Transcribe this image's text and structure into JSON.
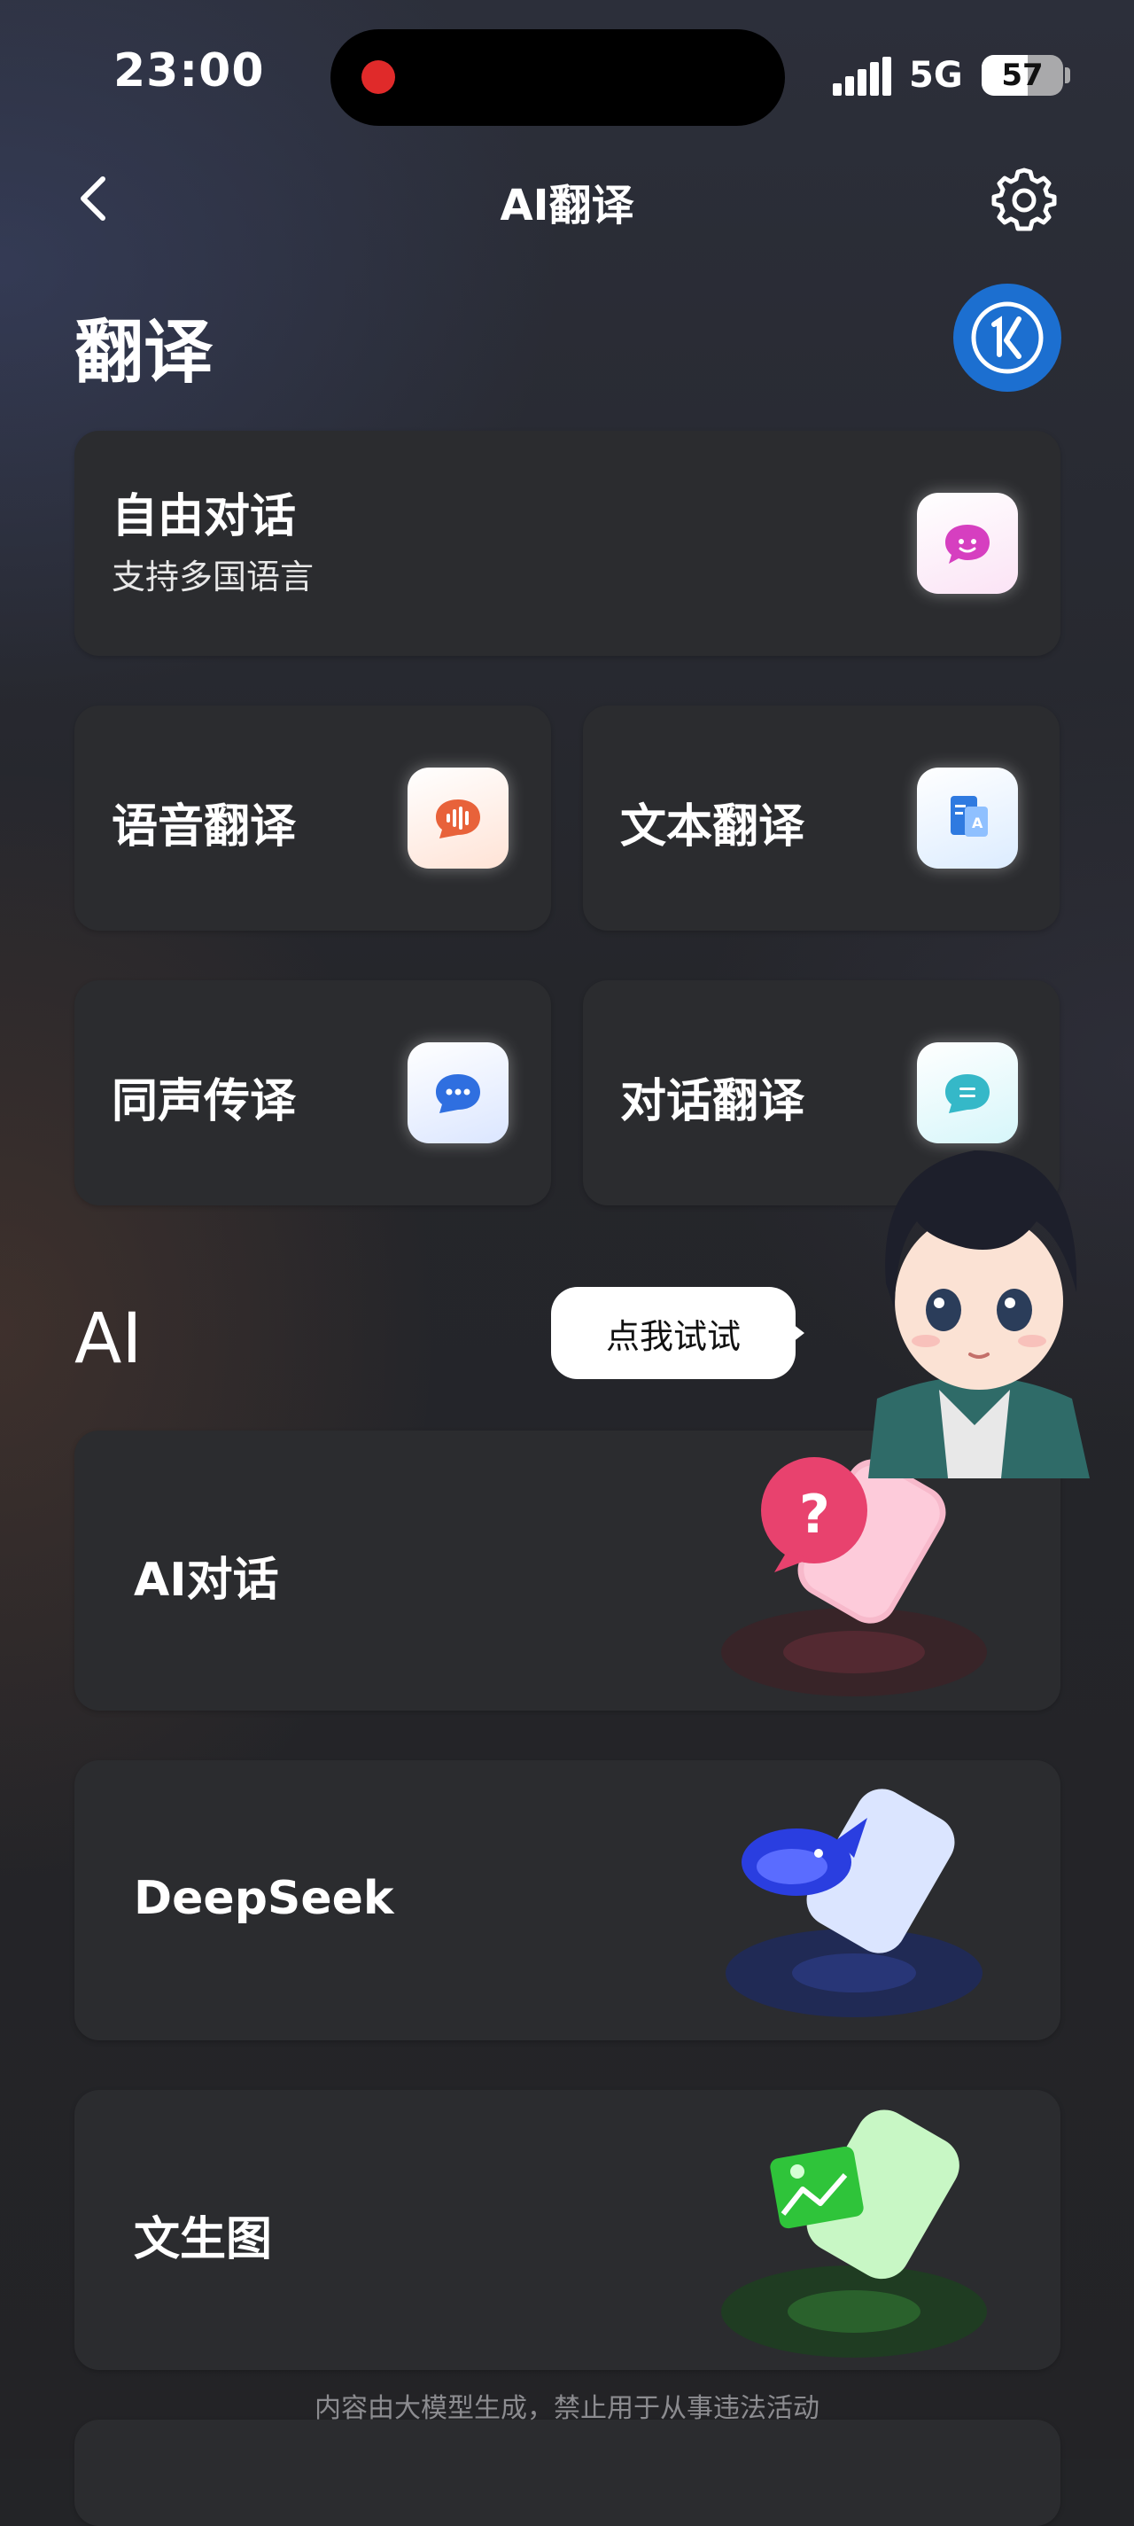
{
  "status_bar": {
    "time": "23:00",
    "network": "5G",
    "battery": "57",
    "battery_level": 0.57
  },
  "nav": {
    "title": "AI翻译",
    "back_icon": "chevron-left-icon",
    "settings_icon": "gear-icon"
  },
  "translate_section": {
    "heading": "翻译",
    "free_chat": {
      "title": "自由对话",
      "subtitle": "支持多国语言",
      "icon": "chat-bubble-icon"
    },
    "tiles": [
      {
        "label": "语音翻译",
        "icon": "voice-wave-icon",
        "color": "#e8623a"
      },
      {
        "label": "文本翻译",
        "icon": "document-icon",
        "color": "#2f7ae0"
      },
      {
        "label": "同声传译",
        "icon": "speech-dots-icon",
        "color": "#2f6fe0"
      },
      {
        "label": "对话翻译",
        "icon": "message-lines-icon",
        "color": "#35b8c8"
      }
    ]
  },
  "ai_section": {
    "heading": "AI",
    "tooltip": "点我试试",
    "cards": [
      {
        "label": "AI对话",
        "icon": "question-bubble-icon",
        "color": "#e8426e"
      },
      {
        "label": "DeepSeek",
        "icon": "whale-icon",
        "color": "#2a3ee0"
      },
      {
        "label": "文生图",
        "icon": "image-icon",
        "color": "#2fc43a"
      }
    ]
  },
  "footer": {
    "disclaimer": "内容由大模型生成，禁止用于从事违法活动"
  }
}
